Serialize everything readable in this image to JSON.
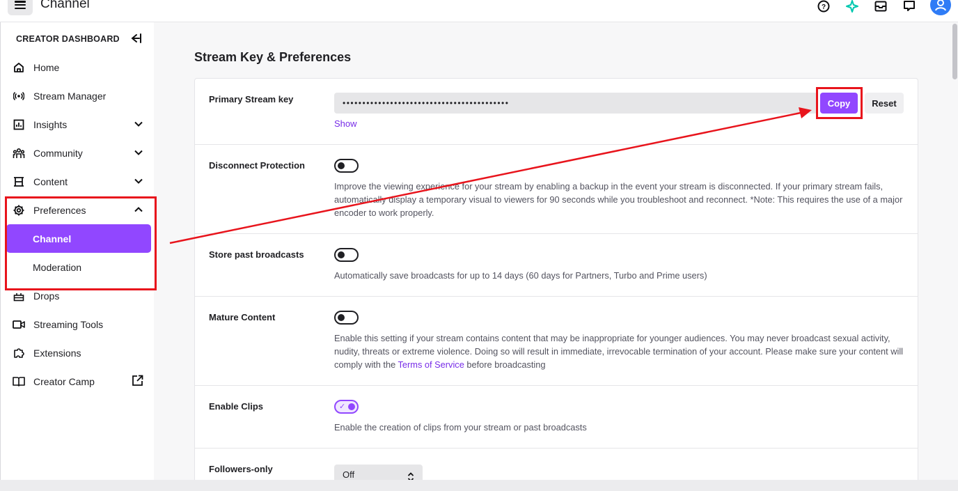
{
  "topbar": {
    "title": "Channel"
  },
  "sidebar": {
    "header": "CREATOR DASHBOARD",
    "items": [
      {
        "label": "Home",
        "icon": "home-icon"
      },
      {
        "label": "Stream Manager",
        "icon": "broadcast-icon"
      },
      {
        "label": "Insights",
        "icon": "insights-icon"
      },
      {
        "label": "Community",
        "icon": "community-icon"
      },
      {
        "label": "Content",
        "icon": "content-icon"
      },
      {
        "label": "Preferences",
        "icon": "gear-icon"
      },
      {
        "label": "Channel"
      },
      {
        "label": "Moderation"
      },
      {
        "label": "Drops",
        "icon": "drops-icon"
      },
      {
        "label": "Streaming Tools",
        "icon": "camera-icon"
      },
      {
        "label": "Extensions",
        "icon": "puzzle-icon"
      },
      {
        "label": "Creator Camp",
        "icon": "book-icon"
      }
    ]
  },
  "main": {
    "page_title": "Stream Key & Preferences",
    "stream_key": {
      "label": "Primary Stream key",
      "masked_value": "••••••••••••••••••••••••••••••••••••••••••",
      "copy_label": "Copy",
      "reset_label": "Reset",
      "show_label": "Show"
    },
    "disconnect_protection": {
      "label": "Disconnect Protection",
      "enabled": false,
      "description": "Improve the viewing experience for your stream by enabling a backup in the event your stream is disconnected. If your primary stream fails, automatically display a temporary visual to viewers for 90 seconds while you troubleshoot and reconnect. *Note: This requires the use of a major encoder to work properly."
    },
    "store_broadcasts": {
      "label": "Store past broadcasts",
      "enabled": false,
      "description": "Automatically save broadcasts for up to 14 days (60 days for Partners, Turbo and Prime users)"
    },
    "mature_content": {
      "label": "Mature Content",
      "enabled": false,
      "description_before": "Enable this setting if your stream contains content that may be inappropriate for younger audiences. You may never broadcast sexual activity, nudity, threats or extreme violence. Doing so will result in immediate, irrevocable termination of your account. Please make sure your content will comply with the ",
      "link_text": "Terms of Service",
      "description_after": " before broadcasting"
    },
    "enable_clips": {
      "label": "Enable Clips",
      "enabled": true,
      "description": "Enable the creation of clips from your stream or past broadcasts"
    },
    "followers_only": {
      "label": "Followers-only",
      "selected": "Off"
    }
  },
  "colors": {
    "accent": "#9147ff",
    "annotation": "#e8141c"
  }
}
